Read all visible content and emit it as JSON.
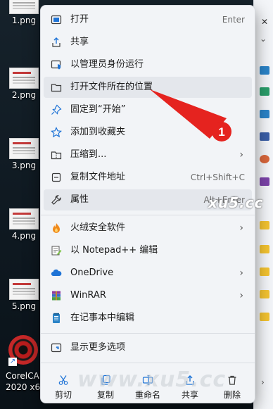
{
  "desktop": {
    "icons": [
      {
        "label": "1.png"
      },
      {
        "label": "2.png"
      },
      {
        "label": "3.png"
      },
      {
        "label": "4.png"
      },
      {
        "label": "5.png"
      }
    ],
    "corel": {
      "label_line1": "CorelCA",
      "label_line2": "2020 x6"
    }
  },
  "menu": {
    "items": [
      {
        "label": "打开",
        "shortcut": "Enter",
        "icon": "open-app-icon"
      },
      {
        "label": "共享",
        "icon": "share-icon"
      },
      {
        "label": "以管理员身份运行",
        "icon": "shield-icon"
      },
      {
        "label": "打开文件所在的位置",
        "icon": "folder-icon"
      },
      {
        "label": "固定到“开始”",
        "icon": "pin-icon"
      },
      {
        "label": "添加到收藏夹",
        "icon": "star-icon"
      },
      {
        "label": "压缩到...",
        "icon": "zip-icon",
        "submenu": true
      },
      {
        "label": "复制文件地址",
        "shortcut": "Ctrl+Shift+C",
        "icon": "copy-path-icon"
      },
      {
        "label": "属性",
        "shortcut": "Alt+Enter",
        "icon": "wrench-icon"
      },
      {
        "label": "火绒安全软件",
        "icon": "huorong-icon",
        "submenu": true
      },
      {
        "label": "以 Notepad++ 编辑",
        "icon": "notepadpp-icon"
      },
      {
        "label": "OneDrive",
        "icon": "cloud-icon",
        "submenu": true
      },
      {
        "label": "WinRAR",
        "icon": "winrar-icon",
        "submenu": true
      },
      {
        "label": "在记事本中编辑",
        "icon": "notepad-icon"
      },
      {
        "label": "显示更多选项",
        "icon": "more-options-icon"
      }
    ],
    "bottom": [
      {
        "label": "剪切",
        "icon": "scissors-icon"
      },
      {
        "label": "复制",
        "icon": "copy-icon"
      },
      {
        "label": "重命名",
        "icon": "rename-icon"
      },
      {
        "label": "共享",
        "icon": "share-icon"
      },
      {
        "label": "删除",
        "icon": "trash-icon"
      }
    ]
  },
  "annotation": {
    "number": "1",
    "color": "#e5231f"
  },
  "watermarks": {
    "small": "xu5.cc",
    "large": "www.xu5.cc"
  },
  "colors": {
    "menu_bg": "#f2f4f7",
    "hover_bg": "#e4e7ec",
    "accent_blue": "#1e73d6"
  }
}
